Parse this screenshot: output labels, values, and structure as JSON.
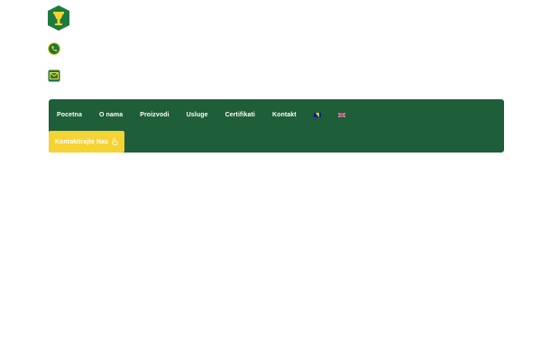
{
  "nav": {
    "items": [
      {
        "label": "Pocetna"
      },
      {
        "label": "O nama"
      },
      {
        "label": "Proizvodi"
      },
      {
        "label": "Usluge"
      },
      {
        "label": "Certifikati"
      },
      {
        "label": "Kontakt"
      }
    ],
    "flags": [
      "bosnia-flag-icon",
      "uk-flag-icon"
    ]
  },
  "cta": {
    "label": "Kontaktirajte Nas"
  },
  "colors": {
    "nav_background": "#1e5e39",
    "cta_background": "#f6d335",
    "logo_green": "#1e7a3e",
    "logo_yellow": "#f6d335"
  },
  "icons": [
    "logo-icon",
    "phone-icon",
    "mail-icon",
    "hand-pointer-icon"
  ]
}
